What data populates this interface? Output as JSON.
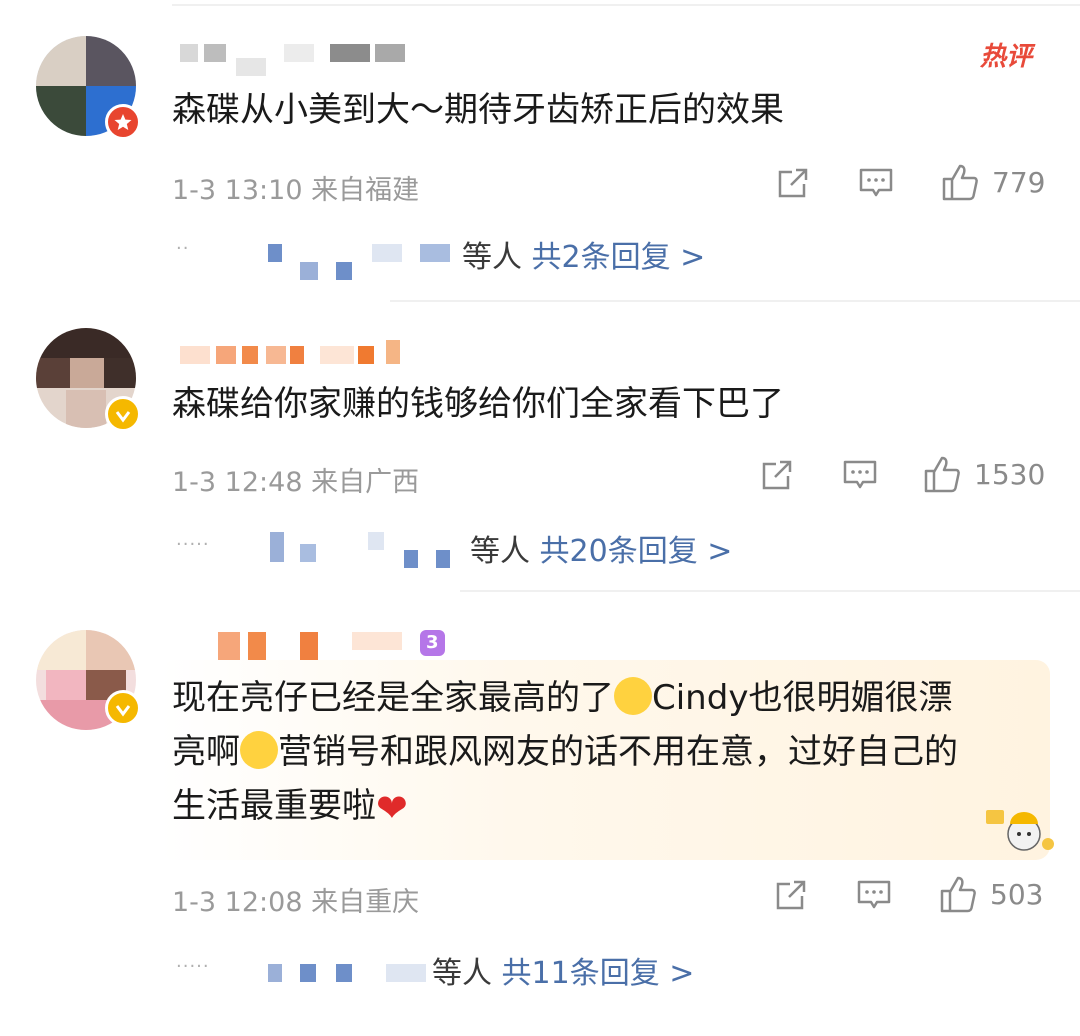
{
  "hot_label": "热评",
  "comments": [
    {
      "text": [
        "森碟从小美到大～期待牙齿矫正后的效果"
      ],
      "time": "1-3 13:10",
      "location": "来自福建",
      "likes": "779",
      "replies_suffix": "等人",
      "replies_link": "共2条回复 >",
      "badge": "red"
    },
    {
      "text": [
        "森碟给你家赚的钱够给你们全家看下巴了"
      ],
      "time": "1-3 12:48",
      "location": "来自广西",
      "likes": "1530",
      "replies_suffix": "等人",
      "replies_link": "共20条回复 >",
      "badge": "gold"
    },
    {
      "text_line1_a": "现在亮仔已经是全家最高的了",
      "text_line1_b": "Cindy也很明媚很漂",
      "text_line2_a": "亮啊",
      "text_line2_b": "营销号和跟风网友的话不用在意，过好自己的",
      "text_line3": "生活最重要啦",
      "time": "1-3 12:08",
      "location": "来自重庆",
      "likes": "503",
      "replies_suffix": "等人",
      "replies_link": "共11条回复 >",
      "level_badge": "3",
      "badge": "gold"
    }
  ],
  "colors": {
    "link": "#4a6fa8",
    "meta": "#9a9a9a",
    "hot": "#e84a3a",
    "verified_gold": "#f5b800",
    "verified_red": "#e8452f"
  },
  "icons": [
    "share-icon",
    "comment-icon",
    "like-icon",
    "heart-emoji",
    "smile-emoji"
  ]
}
